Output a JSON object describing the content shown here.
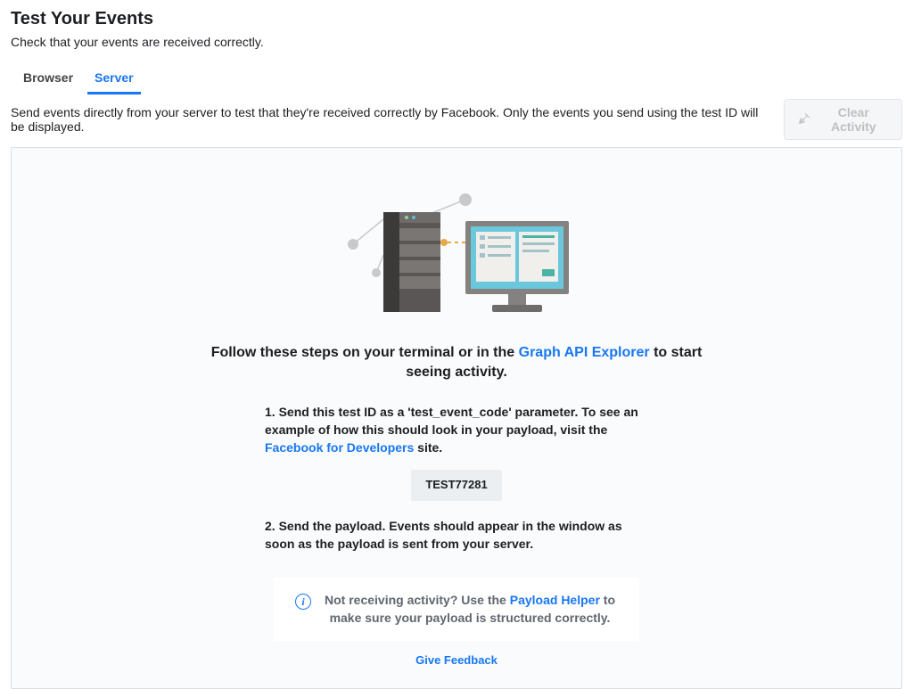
{
  "header": {
    "title": "Test Your Events",
    "subtitle": "Check that your events are received correctly."
  },
  "tabs": {
    "browser": "Browser",
    "server": "Server"
  },
  "toolbar": {
    "description": "Send events directly from your server to test that they're received correctly by Facebook. Only the events you send using the test ID will be displayed.",
    "clear_label": "Clear Activity"
  },
  "instructions": {
    "headline_pre": "Follow these steps on your terminal or in the ",
    "headline_link": "Graph API Explorer",
    "headline_post": " to start seeing activity.",
    "step1_pre": "1. Send this test ID as a 'test_event_code' parameter. To see an example of how this should look in your payload, visit the ",
    "step1_link": "Facebook for Developers",
    "step1_post": " site.",
    "test_code": "TEST77281",
    "step2": "2. Send the payload. Events should appear in the window as soon as the payload is sent from your server."
  },
  "info": {
    "pre": "Not receiving activity? Use the ",
    "link": "Payload Helper",
    "post": " to make sure your payload is structured correctly."
  },
  "footer": {
    "feedback": "Give Feedback"
  }
}
